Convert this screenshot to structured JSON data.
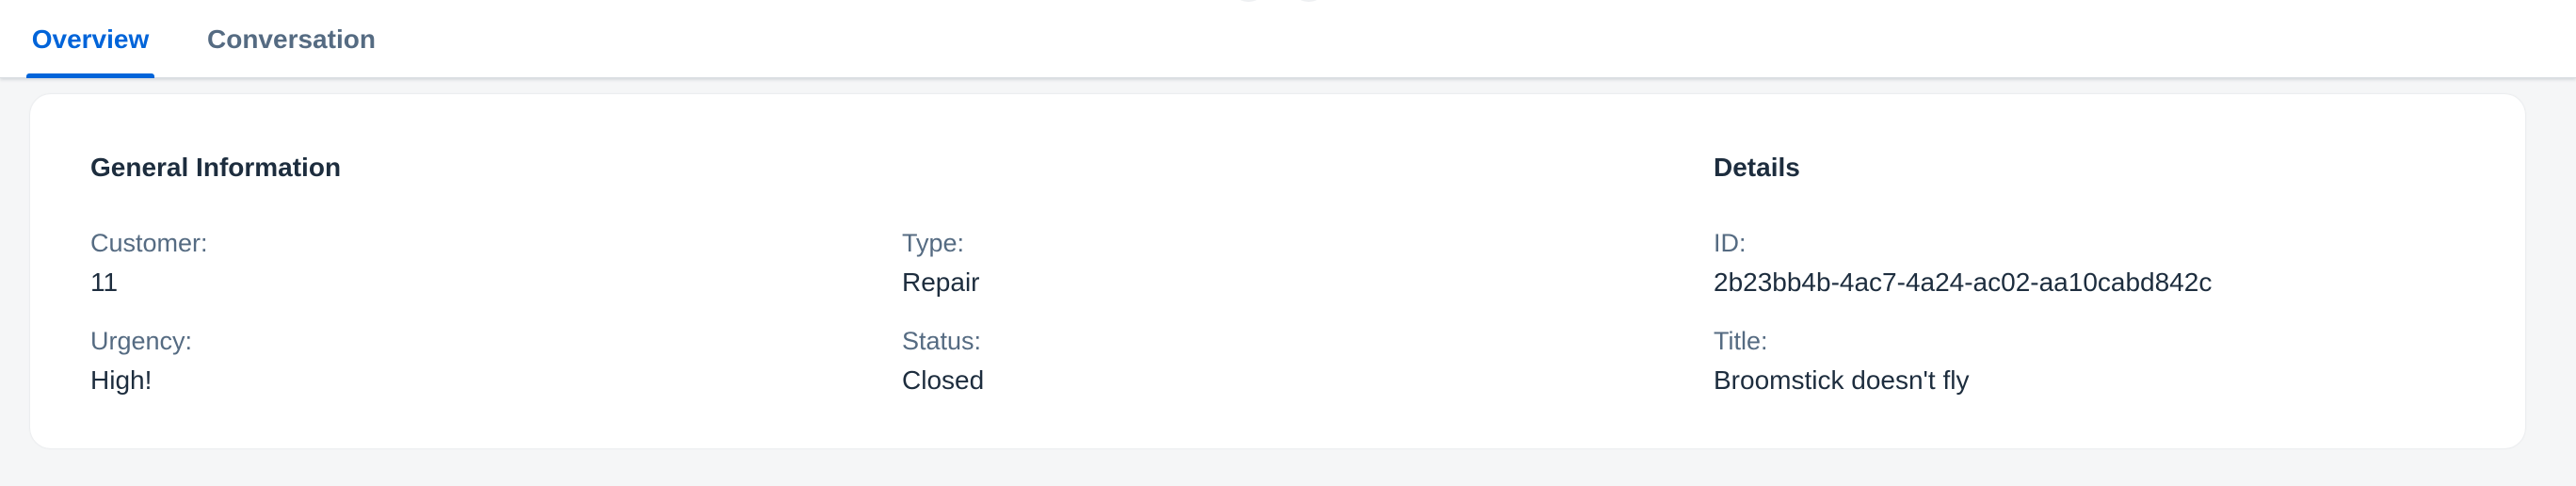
{
  "tabs": [
    {
      "label": "Overview",
      "selected": true
    },
    {
      "label": "Conversation",
      "selected": false
    }
  ],
  "colors": {
    "accent": "#0064d9",
    "text": "#1d2d3e",
    "label": "#556b82",
    "background": "#f5f6f7",
    "card": "#ffffff"
  },
  "general_information": {
    "title": "General Information",
    "customer": {
      "label": "Customer:",
      "value": "11"
    },
    "urgency": {
      "label": "Urgency:",
      "value": "High!"
    },
    "type": {
      "label": "Type:",
      "value": "Repair"
    },
    "status": {
      "label": "Status:",
      "value": "Closed"
    }
  },
  "details": {
    "title": "Details",
    "id": {
      "label": "ID:",
      "value": "2b23bb4b-4ac7-4a24-ac02-aa10cabd842c"
    },
    "item_title": {
      "label": "Title:",
      "value": "Broomstick doesn't fly"
    }
  }
}
